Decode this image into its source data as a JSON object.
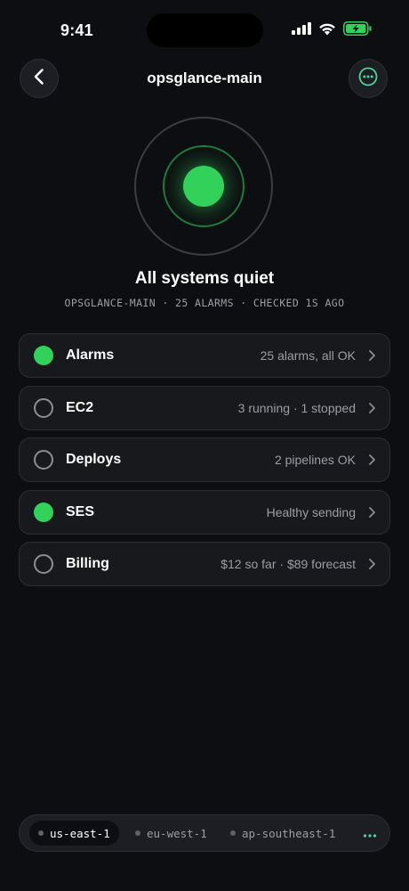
{
  "status_bar": {
    "time": "9:41",
    "icons": [
      "cellular-signal-icon",
      "wifi-icon",
      "battery-charging-icon"
    ]
  },
  "header": {
    "title": "opsglance-main",
    "back_icon": "chevron-left-icon",
    "more_icon": "ellipsis-circle-icon"
  },
  "summary": {
    "title": "All systems quiet",
    "subtitle": "OPSGLANCE-MAIN · 25 ALARMS · CHECKED 1S AGO",
    "status_color": "#32d25a"
  },
  "services": [
    {
      "label": "Alarms",
      "detail": "25 alarms, all OK",
      "state": "ok"
    },
    {
      "label": "EC2",
      "detail": "3 running · 1 stopped",
      "state": "idle"
    },
    {
      "label": "Deploys",
      "detail": "2 pipelines OK",
      "state": "idle"
    },
    {
      "label": "SES",
      "detail": "Healthy sending",
      "state": "ok"
    },
    {
      "label": "Billing",
      "detail": "$12 so far · $89 forecast",
      "state": "idle"
    }
  ],
  "regions": {
    "items": [
      {
        "label": "us-east-1",
        "active": true
      },
      {
        "label": "eu-west-1",
        "active": false
      },
      {
        "label": "ap-southeast-1",
        "active": false
      }
    ],
    "more_icon": "ellipsis-icon"
  },
  "colors": {
    "background": "#0d0e11",
    "card": "#17191d",
    "accent_green": "#32d25a",
    "muted_text": "#9a9ea6"
  }
}
